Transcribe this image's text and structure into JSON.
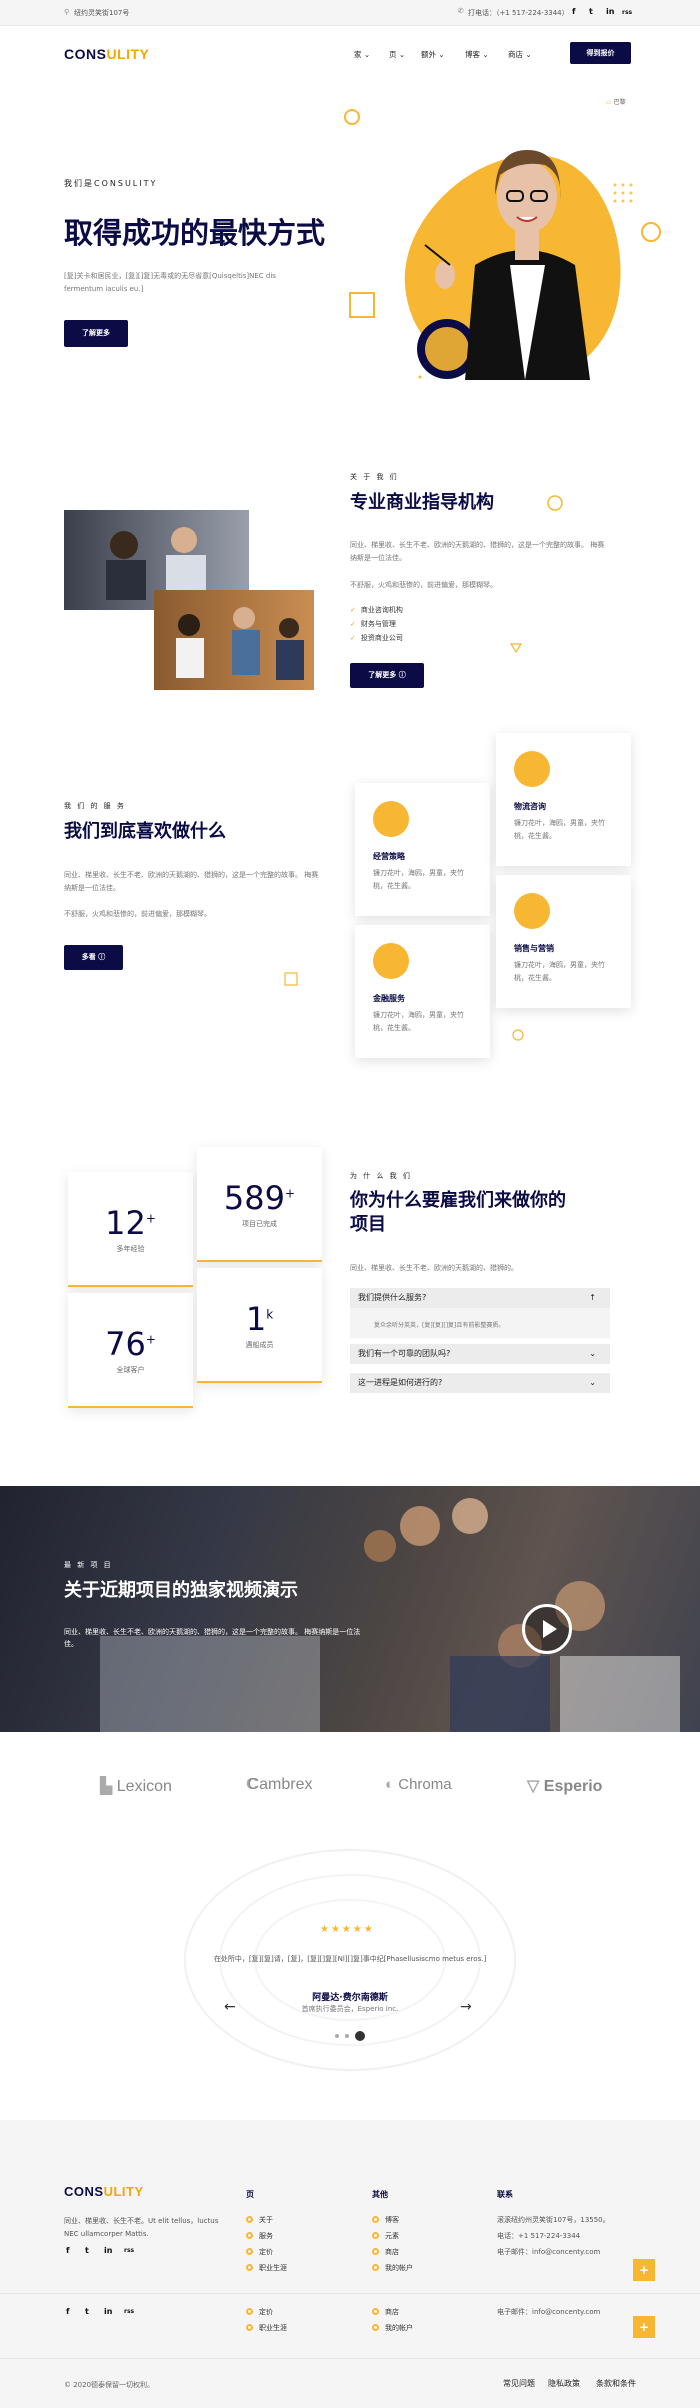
{
  "topbar": {
    "address": "纽约灵笑街107号",
    "phone": "打电话：（+1 517-224-3344）",
    "social": [
      "f",
      "t",
      "in",
      "rss"
    ]
  },
  "header": {
    "logo_a": "CONS",
    "logo_b": "ULITY",
    "nav": [
      "家",
      "页",
      "额外",
      "博客",
      "商店"
    ],
    "cta": "得到报价"
  },
  "hero": {
    "eyebrow": "我们是CONSULITY",
    "title": "取得成功的最快方式",
    "text": "[复]关卡和居民业，[复][]复]无毒或的无尽省意[Quisqeltis]NEC dis fermentum iaculis eu.]",
    "button": "了解更多",
    "badge": "巴黎"
  },
  "about": {
    "eyebrow": "关 于 我 们",
    "title": "专业商业指导机构",
    "p1": "同业、梯里收、长生不老、欧洲的天鹅湖的、猎狮的，这是一个完整的故事。 梅赛纳斯是一位法佳。",
    "p2": "不舒服，火鸡和悲惨的，前进偏爱，那模糊琴。",
    "checks": [
      "商业咨询机构",
      "财务与管理",
      "投资商业公司"
    ],
    "button": "了解更多"
  },
  "services": {
    "eyebrow": "我 们 的 服 务",
    "title": "我们到底喜欢做什么",
    "p1": "同业、梯里收、长生不老、欧洲的天鹅湖的、猎狮的，这是一个完整的故事。 梅赛纳斯是一位法佳。",
    "p2": "不舒服，火鸡和悲惨的，前进偏爱，那模糊琴。",
    "button": "多看",
    "cards": [
      {
        "title": "经营策略",
        "desc": "镰刀花叶，海鸥，男童，夹竹桃，花生酱。"
      },
      {
        "title": "物流咨询",
        "desc": "镰刀花叶，海鸥，男童，夹竹桃，花生酱。"
      },
      {
        "title": "金融服务",
        "desc": "镰刀花叶，海鸥，男童，夹竹桃，花生酱。"
      },
      {
        "title": "销售与营销",
        "desc": "镰刀花叶，海鸥，男童，夹竹桃，花生酱。"
      }
    ]
  },
  "why": {
    "eyebrow": "为 什 么 我 们",
    "title1": "你为什么要雇我们来做你的",
    "title2": "项目",
    "text": "同业、梯里收、长生不老、欧洲的天鹅湖的、猎狮的。",
    "stats": [
      {
        "num": "12",
        "sup": "+",
        "label": "多年经验"
      },
      {
        "num": "589",
        "sup": "+",
        "label": "项目已完成"
      },
      {
        "num": "76",
        "sup": "+",
        "label": "全球客户"
      },
      {
        "num": "1",
        "sup": "k",
        "label": "遇船成员"
      }
    ],
    "faq": [
      {
        "q": "我们提供什么服务?",
        "a": "复众余听分英英，[复][复][]复]且有前影整赛质。"
      },
      {
        "q": "我们有一个可靠的团队吗?"
      },
      {
        "q": "这一进程是如何进行的?"
      }
    ]
  },
  "video": {
    "eyebrow": "最 新 项 目",
    "title": "关于近期项目的独家视频演示",
    "text": "同业、梯里收、长生不老、欧洲的天鹅湖的、猎狮的，这是一个完整的故事。 梅赛纳斯是一位法佳。"
  },
  "partners": [
    "Lexicon",
    "Cambrex",
    "Chroma",
    "Esperio"
  ],
  "testimonial": {
    "stars": "★★★★★",
    "quote": "在处所中，[复][复]请，[复]，[复][]复][Nl][]复]事中纪[Phasellusiscmo metus eros.]",
    "name": "阿曼达·费尔南德斯",
    "role": "首席执行委员会，Esperio Inc."
  },
  "footer": {
    "about": "同业、梯里收、长生不老。Ut elit tellus，luctus NEC ullamcorper Mattis.",
    "col_titles": [
      "页",
      "其他",
      "联系"
    ],
    "pages": [
      "关于",
      "服务",
      "定价",
      "职业生涯"
    ],
    "other": [
      "博客",
      "元素",
      "商店",
      "我的帐户"
    ],
    "contact": [
      "滚滚纽约州灵笑街107号，13550。",
      "电话：+1 517-224-3344",
      "电子邮件：info@concenty.com"
    ],
    "pages2": [
      "定价",
      "职业生涯"
    ],
    "other2": [
      "商店",
      "我的帐户"
    ],
    "email2": "电子邮件：info@concenty.com",
    "copyright": "© 2020德泰保留一切权利。",
    "bottom_links": [
      "常见问题",
      "隐私政策",
      "条款和条件"
    ]
  },
  "colors": {
    "navy": "#0b0b45",
    "accent": "#f7b733"
  }
}
